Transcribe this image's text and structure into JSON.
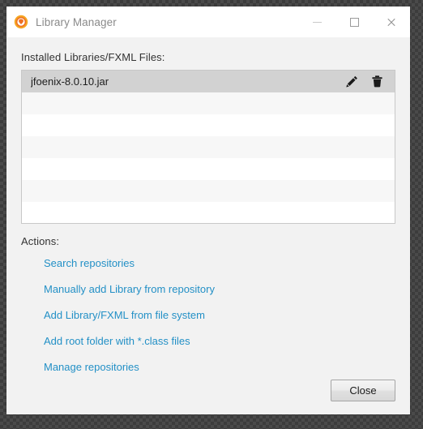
{
  "window": {
    "title": "Library Manager",
    "icon": "app-logo-icon",
    "controls": {
      "minimize": "minimize-icon",
      "maximize": "maximize-icon",
      "close": "close-icon"
    }
  },
  "main": {
    "list_label": "Installed Libraries/FXML Files:",
    "list": {
      "rows": [
        {
          "name": "jfoenix-8.0.10.jar",
          "selected": true,
          "edit_icon": "pencil-icon",
          "delete_icon": "trash-icon"
        },
        {
          "name": "",
          "selected": false
        },
        {
          "name": "",
          "selected": false
        },
        {
          "name": "",
          "selected": false
        },
        {
          "name": "",
          "selected": false
        },
        {
          "name": "",
          "selected": false
        },
        {
          "name": "",
          "selected": false
        }
      ]
    },
    "actions_label": "Actions:",
    "actions": [
      {
        "label": "Search repositories"
      },
      {
        "label": "Manually add Library from repository"
      },
      {
        "label": "Add Library/FXML from file system"
      },
      {
        "label": "Add root folder with *.class files"
      },
      {
        "label": "Manage repositories"
      }
    ]
  },
  "footer": {
    "close_label": "Close"
  },
  "colors": {
    "link": "#2390c6",
    "selected_row": "#d2d2d2",
    "window_bg": "#f2f2f2",
    "title_text": "#8a8a8a",
    "accent_icon": "#f08020"
  }
}
